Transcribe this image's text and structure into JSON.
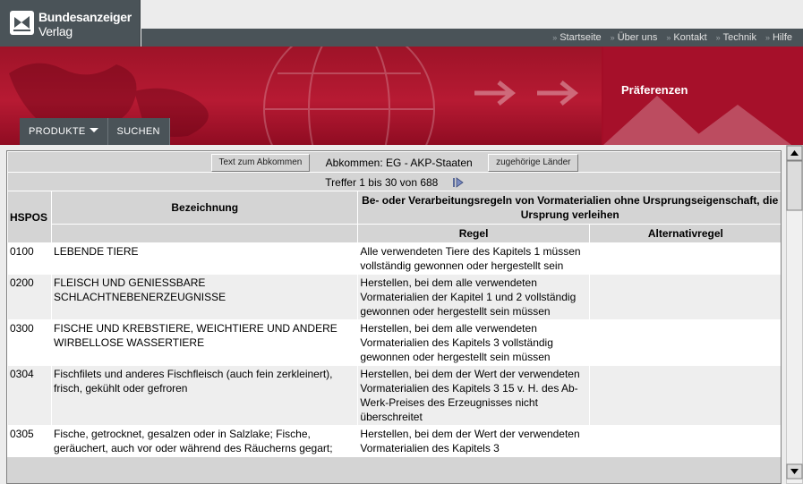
{
  "brand": {
    "line1": "Bundesanzeiger",
    "line2": "Verlag"
  },
  "top_links": [
    "Startseite",
    "Über uns",
    "Kontakt",
    "Technik",
    "Hilfe"
  ],
  "banner": {
    "title": "Präferenzen"
  },
  "tabs": {
    "produkte": "PRODUKTE",
    "suchen": "SUCHEN"
  },
  "controls": {
    "text_button": "Text zum Abkommen",
    "agreement": "Abkommen: EG - AKP-Staaten",
    "countries_button": "zugehörige Länder",
    "hits": "Treffer 1 bis 30 von 688"
  },
  "columns": {
    "hspos": "HSPOS",
    "bezeichnung": "Bezeichnung",
    "rules_group": "Be- oder Verarbeitungsregeln von Vormaterialien ohne Ursprungseigenschaft, die Ursprung verleihen",
    "regel": "Regel",
    "alternativ": "Alternativregel"
  },
  "rows": [
    {
      "hspos": "0100",
      "bezeichnung": "LEBENDE TIERE",
      "regel": "Alle verwendeten Tiere des Kapitels 1 müssen vollständig gewonnen oder hergestellt sein",
      "alternativ": ""
    },
    {
      "hspos": "0200",
      "bezeichnung": "FLEISCH UND GENIESSBARE SCHLACHTNEBENERZEUGNISSE",
      "regel": "Herstellen, bei dem alle verwendeten Vormaterialien der Kapitel 1 und 2 vollständig gewonnen oder hergestellt sein müssen",
      "alternativ": ""
    },
    {
      "hspos": "0300",
      "bezeichnung": "FISCHE UND KREBSTIERE, WEICHTIERE UND ANDERE WIRBELLOSE WASSERTIERE",
      "regel": "Herstellen, bei dem alle verwendeten Vormaterialien des Kapitels 3 vollständig gewonnen oder hergestellt sein müssen",
      "alternativ": ""
    },
    {
      "hspos": "0304",
      "bezeichnung": "Fischfilets und anderes Fischfleisch (auch fein zerkleinert), frisch, gekühlt oder gefroren",
      "regel": "Herstellen, bei dem der Wert der verwendeten Vormaterialien des Kapitels 3 15 v. H. des Ab-Werk-Preises des Erzeugnisses nicht überschreitet",
      "alternativ": ""
    },
    {
      "hspos": "0305",
      "bezeichnung": "Fische, getrocknet, gesalzen oder in Salzlake; Fische, geräuchert, auch vor oder während des Räucherns gegart;",
      "regel": "Herstellen, bei dem der Wert der verwendeten Vormaterialien des Kapitels 3",
      "alternativ": ""
    }
  ]
}
